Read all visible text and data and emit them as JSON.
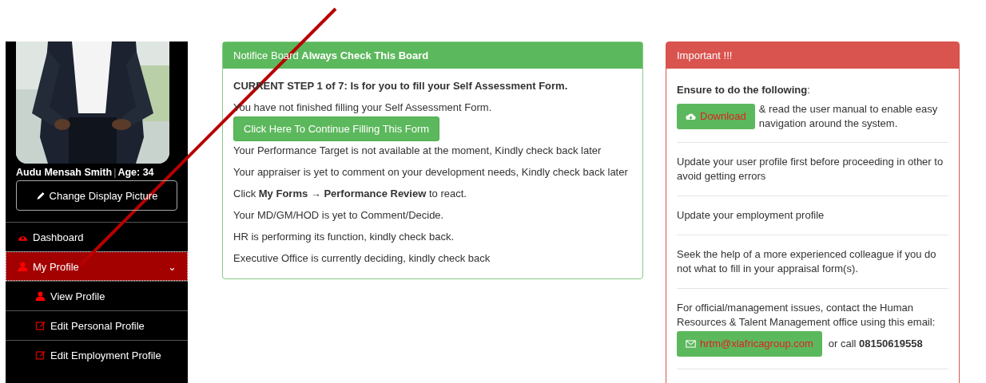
{
  "sidebar": {
    "profile": {
      "name": "Audu Mensah Smith",
      "separator": "|",
      "age": "Age: 34"
    },
    "change_picture_button": "Change Display Picture",
    "menu": [
      {
        "label": "Dashboard",
        "kind": "item",
        "selected": false
      },
      {
        "label": "My Profile",
        "kind": "item",
        "selected": true,
        "expanded": true,
        "caret": "⌄"
      },
      {
        "label": "View Profile",
        "kind": "subitem",
        "selected": false
      },
      {
        "label": "Edit Personal Profile",
        "kind": "subitem",
        "selected": false
      },
      {
        "label": "Edit Employment Profile",
        "kind": "subitem",
        "selected": false
      }
    ]
  },
  "notice_board": {
    "title": "Notifice Board **Always Check This Board**",
    "lines": [
      {
        "kind": "heading",
        "text": "CURRENT STEP 1 of 7: Is for you to fill your Self Assessment Form."
      },
      {
        "kind": "text",
        "text": "You have not finished filling your Self Assessment Form."
      },
      {
        "kind": "button",
        "text": "Click Here To Continue Filling This Form"
      },
      {
        "kind": "text",
        "text": "Your Performance Target is not available at the moment, Kindly check back later"
      },
      {
        "kind": "text",
        "text": "Your appraiser is yet to comment on your development needs, Kindly check back later"
      },
      {
        "kind": "text",
        "text": "Click **My Forms → Performance Review** to react."
      },
      {
        "kind": "text",
        "text": "Your MD/GM/HOD is yet to Comment/Decide."
      },
      {
        "kind": "text",
        "text": "HR is performing its function, kindly check back."
      },
      {
        "kind": "text",
        "text": "Executive Office is currently deciding, kindly check back"
      }
    ]
  },
  "important": {
    "title": "Important !!!",
    "sections": [
      {
        "kind": "download",
        "heading": "**Ensure to do the following**:",
        "button": "Download",
        "text": "& read the user manual to enable easy navigation around the system."
      },
      {
        "kind": "text",
        "text": "Update your user profile first before proceeding in other to avoid getting errors"
      },
      {
        "kind": "text",
        "text": "Update your employment profile"
      },
      {
        "kind": "text",
        "text": "Seek the help of a more experienced colleague if you do not what to fill in your appraisal form(s)."
      },
      {
        "kind": "contact",
        "text": "For official/management issues, contact the Human Resources & Talent Management office using this email:",
        "button": "hrtm@xlafricagroup.com",
        "after": "or call **08150619558**"
      }
    ]
  }
}
